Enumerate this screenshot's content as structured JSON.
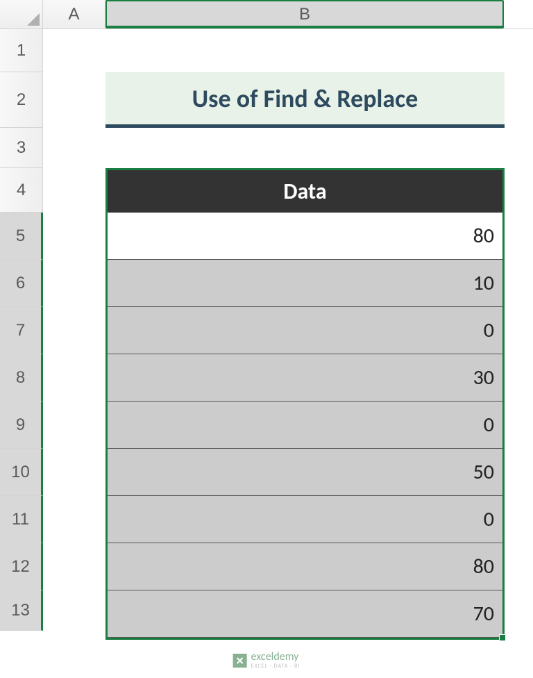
{
  "columns": {
    "a": "A",
    "b": "B"
  },
  "rows": [
    "1",
    "2",
    "3",
    "4",
    "5",
    "6",
    "7",
    "8",
    "9",
    "10",
    "11",
    "12",
    "13"
  ],
  "title": "Use of Find & Replace",
  "data_header": "Data",
  "data_values": [
    "80",
    "10",
    "0",
    "30",
    "0",
    "50",
    "0",
    "80",
    "70"
  ],
  "watermark": {
    "brand": "exceldemy",
    "tagline": "EXCEL · DATA · BI"
  }
}
